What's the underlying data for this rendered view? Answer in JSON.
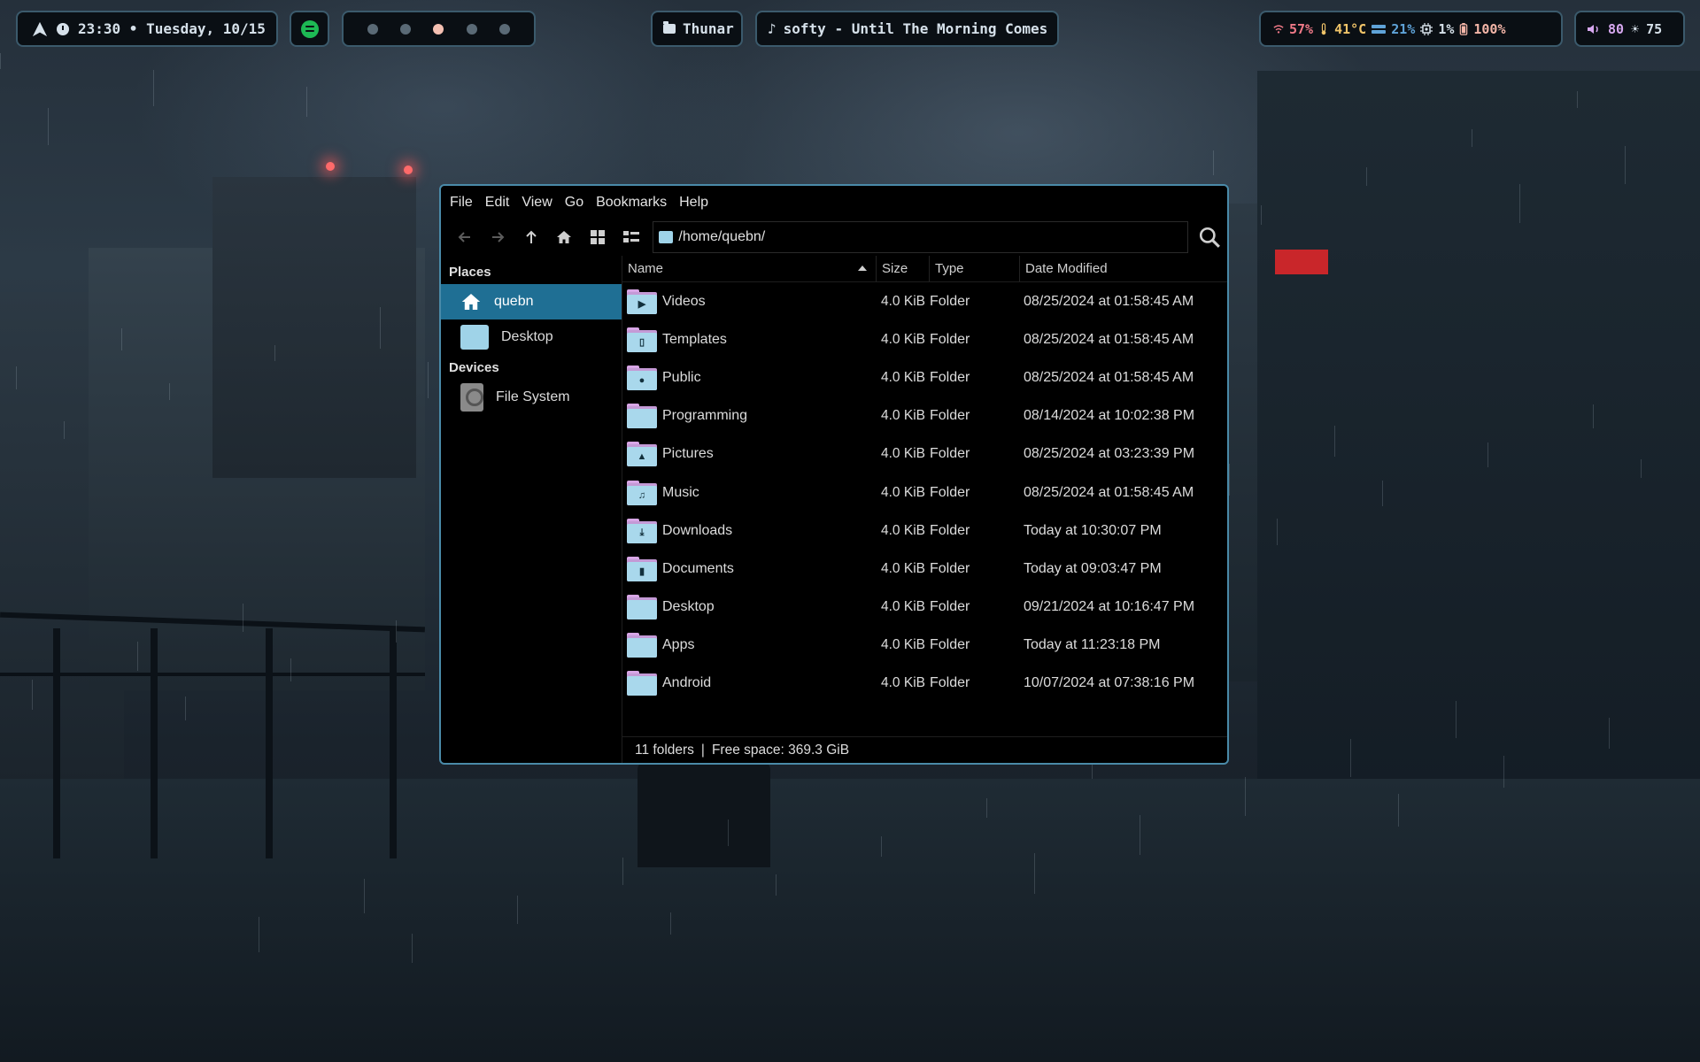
{
  "topbar": {
    "clock": "23:30 • Tuesday, 10/15",
    "workspaces": [
      {
        "active": false
      },
      {
        "active": false
      },
      {
        "active": true
      },
      {
        "active": false
      },
      {
        "active": false
      }
    ],
    "active_app": "Thunar",
    "now_playing": "softy - Until The Morning Comes",
    "wifi": "57%",
    "temperature": "41°C",
    "memory": "21%",
    "cpu": "1%",
    "battery": "100%",
    "volume": "80",
    "brightness": "75",
    "colors": {
      "wifi": "#f07a88",
      "temperature": "#f0c469",
      "memory": "#5fa3d8",
      "battery": "#f4b6a8",
      "volume": "#d7a8f0",
      "spotify": "#1db954"
    }
  },
  "window": {
    "menu": [
      "File",
      "Edit",
      "View",
      "Go",
      "Bookmarks",
      "Help"
    ],
    "toolbar_icons": [
      "back-arrow-icon",
      "forward-arrow-icon",
      "up-arrow-icon",
      "home-icon",
      "icon-view-icon",
      "list-view-icon"
    ],
    "location": "/home/quebn/",
    "sidebar": {
      "places_label": "Places",
      "places": [
        {
          "label": "quebn",
          "icon": "home-icon",
          "selected": true
        },
        {
          "label": "Desktop",
          "icon": "desktop-folder-icon",
          "selected": false
        }
      ],
      "devices_label": "Devices",
      "devices": [
        {
          "label": "File System",
          "icon": "drive-icon"
        }
      ]
    },
    "columns": {
      "name": "Name",
      "size": "Size",
      "type": "Type",
      "date": "Date Modified"
    },
    "files": [
      {
        "name": "Videos",
        "size": "4.0 KiB",
        "type": "Folder",
        "date": "08/25/2024 at 01:58:45 AM",
        "emblem": "▶"
      },
      {
        "name": "Templates",
        "size": "4.0 KiB",
        "type": "Folder",
        "date": "08/25/2024 at 01:58:45 AM",
        "emblem": "▯"
      },
      {
        "name": "Public",
        "size": "4.0 KiB",
        "type": "Folder",
        "date": "08/25/2024 at 01:58:45 AM",
        "emblem": "●"
      },
      {
        "name": "Programming",
        "size": "4.0 KiB",
        "type": "Folder",
        "date": "08/14/2024 at 10:02:38 PM",
        "emblem": ""
      },
      {
        "name": "Pictures",
        "size": "4.0 KiB",
        "type": "Folder",
        "date": "08/25/2024 at 03:23:39 PM",
        "emblem": "▲"
      },
      {
        "name": "Music",
        "size": "4.0 KiB",
        "type": "Folder",
        "date": "08/25/2024 at 01:58:45 AM",
        "emblem": "♫"
      },
      {
        "name": "Downloads",
        "size": "4.0 KiB",
        "type": "Folder",
        "date": "Today at 10:30:07 PM",
        "emblem": "⤓"
      },
      {
        "name": "Documents",
        "size": "4.0 KiB",
        "type": "Folder",
        "date": "Today at 09:03:47 PM",
        "emblem": "▮"
      },
      {
        "name": "Desktop",
        "size": "4.0 KiB",
        "type": "Folder",
        "date": "09/21/2024 at 10:16:47 PM",
        "emblem": ""
      },
      {
        "name": "Apps",
        "size": "4.0 KiB",
        "type": "Folder",
        "date": "Today at 11:23:18 PM",
        "emblem": ""
      },
      {
        "name": "Android",
        "size": "4.0 KiB",
        "type": "Folder",
        "date": "10/07/2024 at 07:38:16 PM",
        "emblem": ""
      }
    ],
    "status": {
      "count": "11 folders",
      "separator": "|",
      "free": "Free space: 369.3 GiB"
    }
  }
}
